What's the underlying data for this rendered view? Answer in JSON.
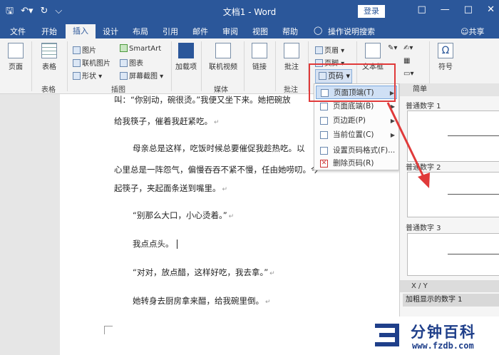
{
  "titlebar": {
    "doc_title": "文档1 - Word",
    "login": "登录",
    "qat": [
      "save-icon",
      "undo-icon",
      "redo-icon",
      "customize-icon"
    ]
  },
  "tabs": [
    "文件",
    "开始",
    "插入",
    "设计",
    "布局",
    "引用",
    "邮件",
    "审阅",
    "视图",
    "帮助",
    "操作说明搜索",
    "共享"
  ],
  "ribbon": {
    "pages": "页面",
    "table": "表格",
    "table_group": "表格",
    "pictures": "图片",
    "online_pictures": "联机图片",
    "shapes": "形状",
    "smartart": "SmartArt",
    "chart": "图表",
    "screenshot": "屏幕截图",
    "illustrations_group": "插图",
    "addins": "加载项",
    "online_video": "联机视频",
    "media_group": "媒体",
    "link": "链接",
    "comment": "批注",
    "comment_group": "批注",
    "header": "页眉",
    "footer": "页脚",
    "page_number": "页码",
    "textbox": "文本框",
    "symbol": "符号"
  },
  "document": {
    "lines": [
      "叫：“你别动，碗很烫。”我便又坐下来。她把碗放",
      "给我筷子，催着我赶紧吃。",
      "母亲总是这样，吃饭时候总要催促我趁热吃。以",
      "心里总是一阵怨气，偏慢吞吞不紧不慢，任由她唠叨。今",
      "起筷子，夹起面条送到嘴里。",
      "“别那么大口，小心烫着。”",
      "我点点头。",
      "“对对，放点醋，这样好吃，我去拿。”",
      "她转身去厨房拿来醋，给我碗里倒。"
    ],
    "paragraph_mark": "↵"
  },
  "menu": {
    "items": [
      {
        "label": "页面顶端(T)",
        "submenu": true,
        "enabled": true
      },
      {
        "label": "页面底端(B)",
        "submenu": true,
        "enabled": true
      },
      {
        "label": "页边距(P)",
        "submenu": true,
        "enabled": true
      },
      {
        "label": "当前位置(C)",
        "submenu": true,
        "enabled": true
      },
      {
        "label": "设置页码格式(F)...",
        "submenu": false,
        "enabled": true
      },
      {
        "label": "删除页码(R)",
        "submenu": false,
        "enabled": true
      }
    ]
  },
  "gallery": {
    "section": "简单",
    "items": [
      "普通数字 1",
      "普通数字 2",
      "普通数字 3"
    ],
    "section2": "X / Y",
    "item2": "加粗显示的数字 1"
  },
  "brand": {
    "name": "分钟百科",
    "url": "www.fzdb.com"
  },
  "colors": {
    "title_blue": "#2b579a",
    "highlight_red": "#e03a3a"
  }
}
